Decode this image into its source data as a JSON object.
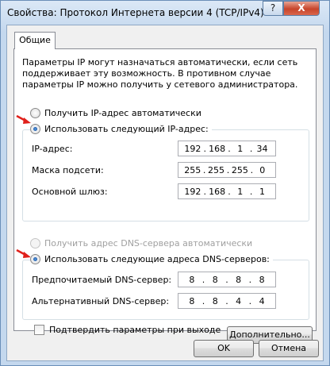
{
  "window": {
    "title": "Свойства: Протокол Интернета версии 4 (TCP/IPv4)",
    "help_label": "?",
    "close_label": "X"
  },
  "tab": {
    "label": "Общие"
  },
  "description": "Параметры IP могут назначаться автоматически, если сеть поддерживает эту возможность. В противном случае параметры IP можно получить у сетевого администратора.",
  "ip": {
    "auto_label": "Получить IP-адрес автоматически",
    "manual_label": "Использовать следующий IP-адрес:",
    "selected": "manual",
    "fields": [
      {
        "label": "IP-адрес:",
        "octets": [
          "192",
          "168",
          "1",
          "34"
        ]
      },
      {
        "label": "Маска подсети:",
        "octets": [
          "255",
          "255",
          "255",
          "0"
        ]
      },
      {
        "label": "Основной шлюз:",
        "octets": [
          "192",
          "168",
          "1",
          "1"
        ]
      }
    ]
  },
  "dns": {
    "auto_label": "Получить адрес DNS-сервера автоматически",
    "auto_disabled": true,
    "manual_label": "Использовать следующие адреса DNS-серверов:",
    "selected": "manual",
    "fields": [
      {
        "label": "Предпочитаемый DNS-сервер:",
        "octets": [
          "8",
          "8",
          "8",
          "8"
        ]
      },
      {
        "label": "Альтернативный DNS-сервер:",
        "octets": [
          "8",
          "8",
          "4",
          "4"
        ]
      }
    ]
  },
  "validate": {
    "label": "Подтвердить параметры при выходе",
    "checked": false
  },
  "advanced_label": "Дополнительно...",
  "ok_label": "OK",
  "cancel_label": "Отмена",
  "colors": {
    "annotation_arrow": "#e0201b",
    "radio_dot": "#0b3f8c"
  },
  "icons": [
    "red-arrow-icon"
  ]
}
